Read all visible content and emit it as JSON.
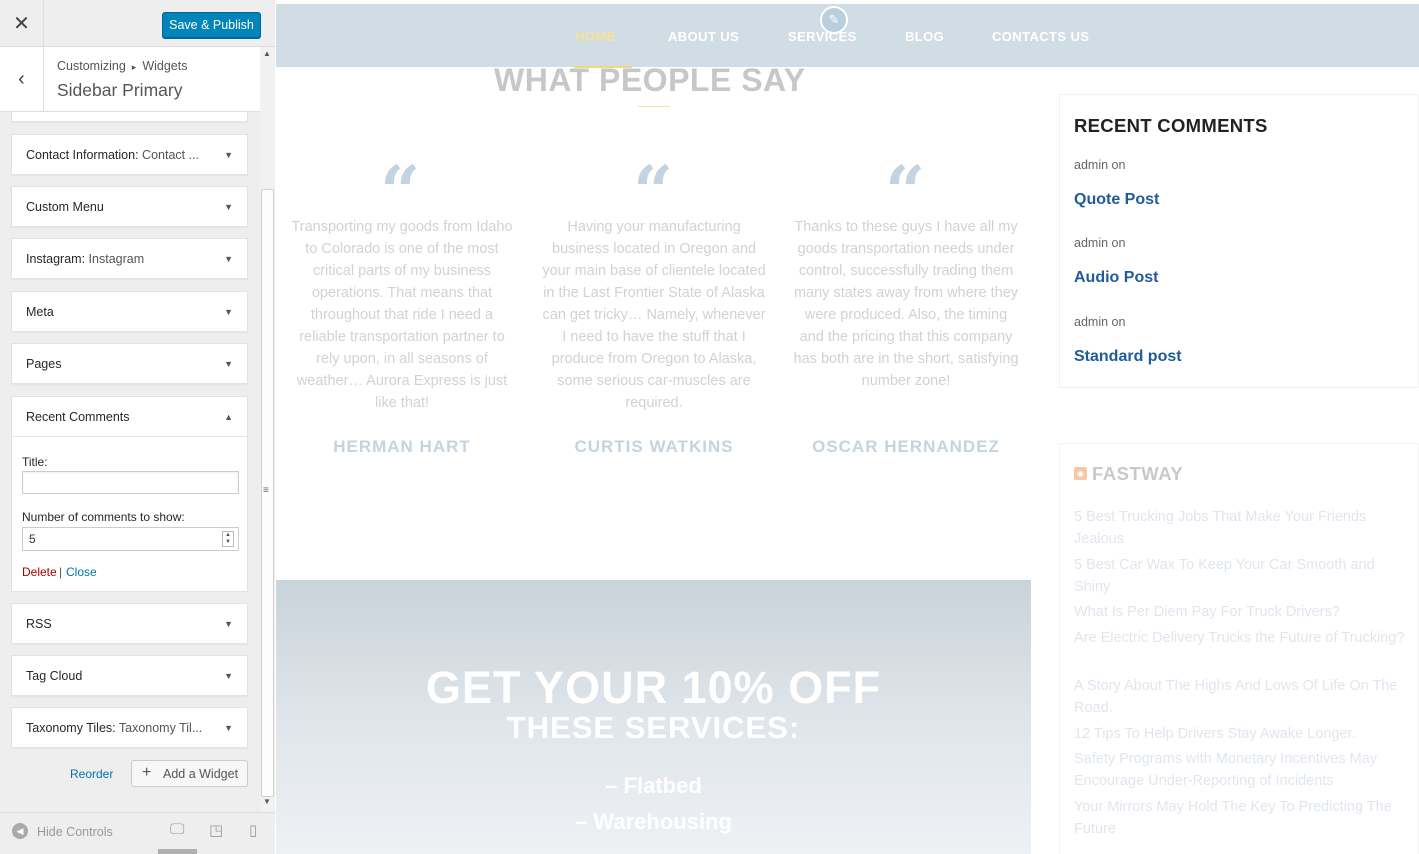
{
  "customizer": {
    "close_icon": "close-icon",
    "save_publish": "Save & Publish",
    "breadcrumb": {
      "root": "Customizing",
      "section": "Widgets"
    },
    "section_title": "Sidebar Primary",
    "widgets": [
      {
        "title": "Contact Information:",
        "sub": "Contact ..."
      },
      {
        "title": "Custom Menu",
        "sub": ""
      },
      {
        "title": "Instagram:",
        "sub": "Instagram"
      },
      {
        "title": "Meta",
        "sub": ""
      },
      {
        "title": "Pages",
        "sub": ""
      },
      {
        "title": "Recent Comments",
        "sub": ""
      },
      {
        "title": "RSS",
        "sub": ""
      },
      {
        "title": "Tag Cloud",
        "sub": ""
      },
      {
        "title": "Taxonomy Tiles:",
        "sub": "Taxonomy Til..."
      }
    ],
    "recent_comments_form": {
      "title_label": "Title:",
      "title_value": "",
      "count_label": "Number of comments to show:",
      "count_value": "5",
      "delete": "Delete",
      "separator": "|",
      "close": "Close"
    },
    "reorder": "Reorder",
    "add_widget": "Add a Widget",
    "hide_controls": "Hide Controls"
  },
  "preview": {
    "nav": [
      "HOME",
      "ABOUT US",
      "SERVICES",
      "BLOG",
      "CONTACTS US"
    ],
    "section_heading": "WHAT PEOPLE SAY",
    "quote_mark": "“",
    "testimonials": [
      {
        "text": "Transporting my goods from Idaho to Colorado is one of the most critical parts of my business operations. That means that throughout that ride I need a reliable transportation partner to rely upon, in all seasons of weather… Aurora Express is just like that!",
        "author": "HERMAN HART"
      },
      {
        "text": "Having your manufacturing business located in Oregon and your main base of clientele located in the Last Frontier State of Alaska can get tricky… Namely, whenever I need to have the stuff that I produce from Oregon to Alaska, some serious car-muscles are required.",
        "author": "CURTIS WATKINS"
      },
      {
        "text": "Thanks to these guys I have all my goods transportation needs under control, successfully trading them many states away from where they were produced. Also, the timing and the pricing that this company has both are in the short, satisfying number zone!",
        "author": "OSCAR HERNANDEZ"
      }
    ],
    "promo": {
      "line1": "GET YOUR 10% OFF",
      "line2": "THESE SERVICES:",
      "items": [
        "– Flatbed",
        "– Warehousing"
      ]
    },
    "recent_comments": {
      "heading": "RECENT COMMENTS",
      "items": [
        {
          "author": "admin on",
          "post": "Quote Post"
        },
        {
          "author": "admin on",
          "post": "Audio Post"
        },
        {
          "author": "admin on",
          "post": "Standard post"
        }
      ]
    },
    "fastway": {
      "heading": "FASTWAY",
      "items": [
        "5 Best Trucking Jobs That Make Your Friends Jealous",
        "5 Best Car Wax To Keep Your Car Smooth and Shiny",
        "What Is Per Diem Pay For Truck Drivers?",
        "Are Electric Delivery Trucks the Future of Trucking?",
        "A Story About The Highs And Lows Of Life On The Road.",
        "12 Tips To Help Drivers Stay Awake Longer.",
        "Safety Programs with Monetary Incentives May Encourage Under-Reporting of Incidents",
        "Your Mirrors May Hold The Key To Predicting The Future"
      ]
    }
  },
  "colors": {
    "publish_blue": "#0085ba",
    "link_blue": "#0073aa",
    "delete_red": "#a00000",
    "nav_bg": "#d0dde5",
    "nav_active": "#f7e29b",
    "post_link": "#1f5c9b"
  }
}
